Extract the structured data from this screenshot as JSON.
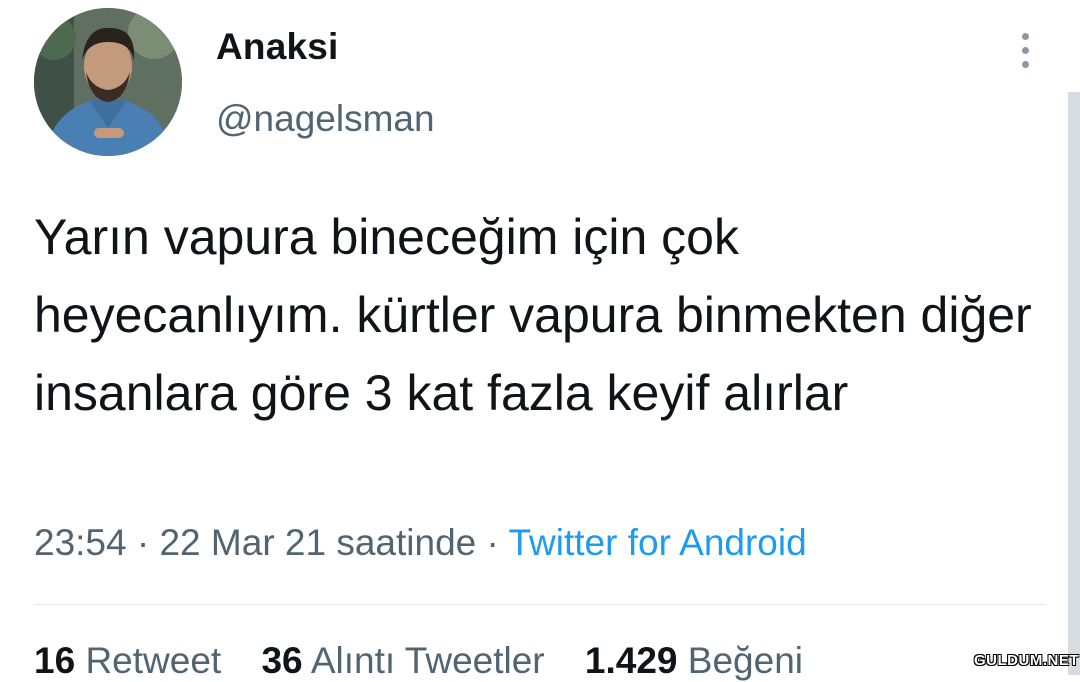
{
  "user": {
    "display_name": "Anaksi",
    "username": "@nagelsman"
  },
  "tweet": {
    "text": "Yarın vapura bineceğim için çok heyecanlıyım. kürtler vapura binmekten diğer insanlara göre 3 kat fazla keyif alırlar",
    "time": "23:54",
    "separator": "·",
    "date": "22 Mar 21 saatinde",
    "source": "Twitter for Android"
  },
  "stats": {
    "retweets": {
      "count": "16",
      "label": "Retweet"
    },
    "quotes": {
      "count": "36",
      "label": "Alıntı Tweetler"
    },
    "likes": {
      "count": "1.429",
      "label": "Beğeni"
    }
  },
  "watermark": "GULDUM.NET",
  "icons": {
    "more": "more-vertical-icon"
  },
  "colors": {
    "text": "#0f1419",
    "secondary": "#536471",
    "link": "#1d9bf0"
  }
}
